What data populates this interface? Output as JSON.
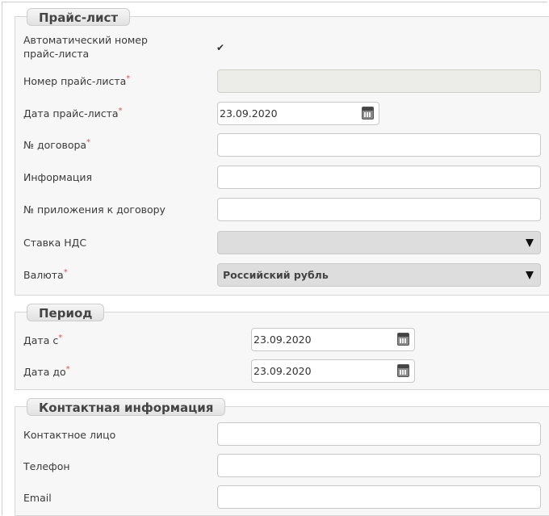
{
  "price_list": {
    "legend": "Прайс-лист",
    "auto_number": {
      "label_line1": "Автоматический номер",
      "label_line2": "прайс-листа",
      "check_mark": "✔"
    },
    "number": {
      "label": "Номер прайс-листа",
      "value": ""
    },
    "date": {
      "label": "Дата прайс-листа",
      "value": "23.09.2020"
    },
    "contract_no": {
      "label": "№ договора",
      "value": ""
    },
    "info": {
      "label": "Информация",
      "value": ""
    },
    "appendix_no": {
      "label": "№ приложения к договору",
      "value": ""
    },
    "vat_rate": {
      "label": "Ставка НДС",
      "value": ""
    },
    "currency": {
      "label": "Валюта",
      "value": "Российский рубль"
    }
  },
  "period": {
    "legend": "Период",
    "date_from": {
      "label": "Дата с",
      "value": "23.09.2020"
    },
    "date_to": {
      "label": "Дата до",
      "value": "23.09.2020"
    }
  },
  "contact": {
    "legend": "Контактная информация",
    "person": {
      "label": "Контактное лицо",
      "value": ""
    },
    "phone": {
      "label": "Телефон",
      "value": ""
    },
    "email": {
      "label": "Email",
      "value": ""
    }
  },
  "required_mark": "*"
}
